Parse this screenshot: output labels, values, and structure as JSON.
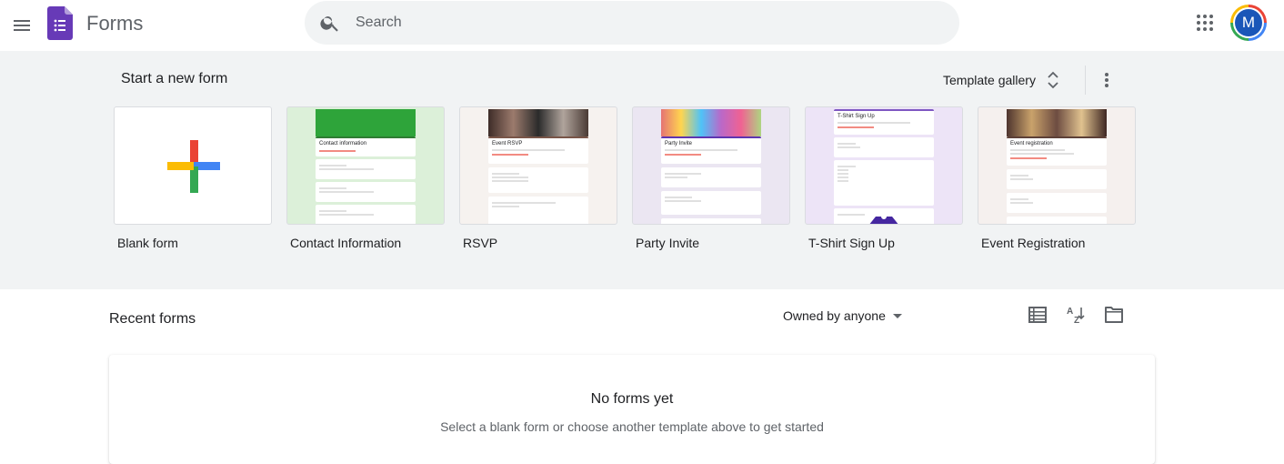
{
  "header": {
    "app_title": "Forms",
    "search_placeholder": "Search",
    "avatar_initial": "M"
  },
  "templates": {
    "section_title": "Start a new form",
    "gallery_label": "Template gallery",
    "items": [
      {
        "label": "Blank form"
      },
      {
        "label": "Contact Information",
        "preview_title": "Contact information",
        "accent": "#3aa757"
      },
      {
        "label": "RSVP",
        "preview_title": "Event RSVP",
        "accent": "#8d6e63"
      },
      {
        "label": "Party Invite",
        "preview_title": "Party Invite",
        "accent": "#5e4b8b"
      },
      {
        "label": "T-Shirt Sign Up",
        "preview_title": "T-Shirt Sign Up",
        "accent": "#7e57c2"
      },
      {
        "label": "Event Registration",
        "preview_title": "Event registration",
        "accent": "#6d4c41"
      }
    ]
  },
  "recent": {
    "title": "Recent forms",
    "owner_filter": "Owned by anyone",
    "empty_title": "No forms yet",
    "empty_subtitle": "Select a blank form or choose another template above to get started"
  },
  "colors": {
    "brand_purple": "#673ab7",
    "band_bg": "#f1f3f4",
    "google_red": "#ea4335",
    "google_blue": "#4285f4",
    "google_green": "#34a853",
    "google_yellow": "#fbbc04"
  }
}
